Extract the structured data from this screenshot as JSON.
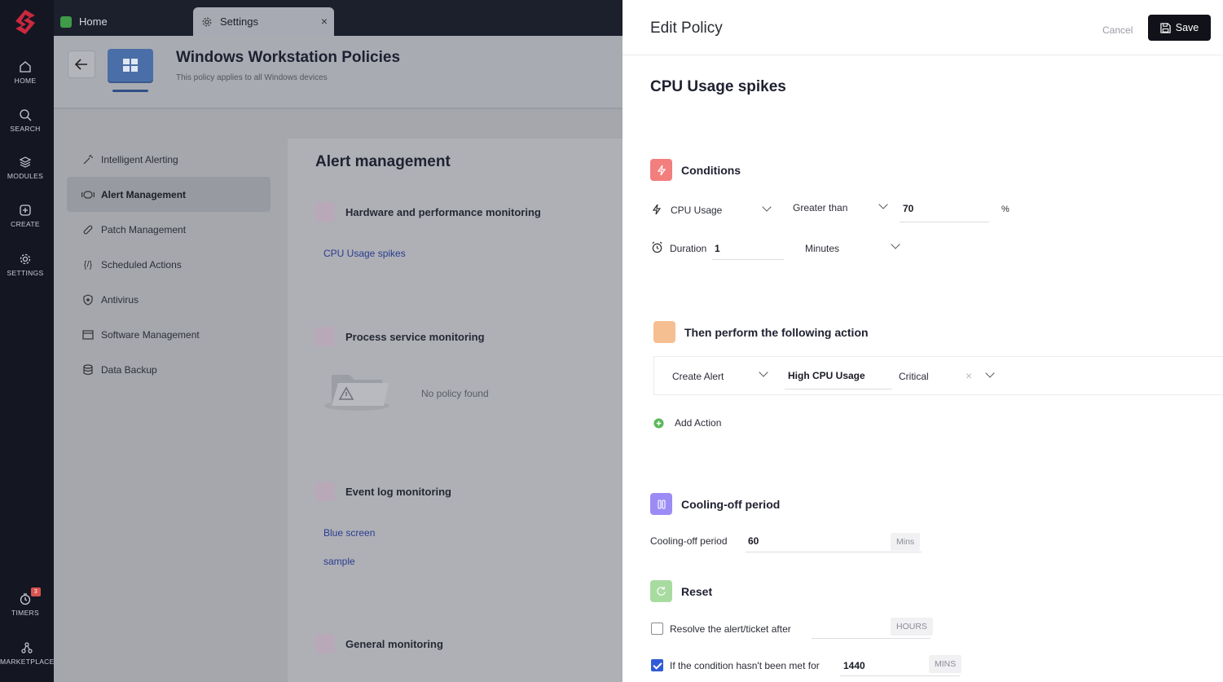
{
  "rail": {
    "items": [
      {
        "label": "HOME",
        "icon": "home-icon"
      },
      {
        "label": "SEARCH",
        "icon": "search-icon"
      },
      {
        "label": "MODULES",
        "icon": "layers-icon"
      },
      {
        "label": "CREATE",
        "icon": "plus-square-icon"
      },
      {
        "label": "SETTINGS",
        "icon": "gear-icon"
      },
      {
        "label": "TIMERS",
        "icon": "timer-icon",
        "badge": "3"
      },
      {
        "label": "MARKETPLACE",
        "icon": "marketplace-icon"
      }
    ]
  },
  "tabs": {
    "home": "Home",
    "settings": "Settings",
    "close": "×"
  },
  "header": {
    "title": "Windows Workstation Policies",
    "subtitle": "This policy applies to all Windows devices"
  },
  "subnav": {
    "items": [
      {
        "label": "Intelligent Alerting",
        "icon": "wand-icon",
        "active": false
      },
      {
        "label": "Alert Management",
        "icon": "radar-icon",
        "active": true
      },
      {
        "label": "Patch Management",
        "icon": "bandage-icon",
        "active": false
      },
      {
        "label": "Scheduled Actions",
        "icon": "code-icon",
        "active": false
      },
      {
        "label": "Antivirus",
        "icon": "shield-icon",
        "active": false
      },
      {
        "label": "Software Management",
        "icon": "window-code-icon",
        "active": false
      },
      {
        "label": "Data Backup",
        "icon": "database-icon",
        "active": false
      }
    ]
  },
  "panel": {
    "title": "Alert management",
    "sections": {
      "hardware": "Hardware and performance monitoring",
      "process": "Process service monitoring",
      "eventlog": "Event log monitoring",
      "general": "General monitoring"
    },
    "links": {
      "cpu": "CPU Usage spikes",
      "blue_screen": "Blue screen",
      "sample": "sample"
    },
    "no_policy": "No policy found"
  },
  "drawer": {
    "title": "Edit Policy",
    "cancel": "Cancel",
    "save": "Save",
    "policy_name": "CPU Usage spikes",
    "conditions": {
      "heading": "Conditions",
      "metric": "CPU Usage",
      "operator": "Greater than",
      "threshold": "70",
      "unit": "%",
      "duration_label": "Duration",
      "duration_value": "1",
      "duration_unit": "Minutes"
    },
    "actions": {
      "heading": "Then perform the following action",
      "type": "Create Alert",
      "name": "High CPU Usage",
      "severity": "Critical",
      "add": "Add Action"
    },
    "cooling": {
      "heading": "Cooling-off period",
      "label": "Cooling-off period",
      "value": "60",
      "unit": "Mins"
    },
    "reset": {
      "heading": "Reset",
      "resolve_label": "Resolve the alert/ticket after",
      "resolve_checked": false,
      "resolve_unit": "HOURS",
      "condition_label": "If the condition hasn't been met for",
      "condition_checked": true,
      "condition_value": "1440",
      "condition_unit": "MINS"
    }
  },
  "colors": {
    "conditions_icon": "#f27e7e",
    "action_icon": "#f6bf92",
    "cooling_icon": "#9b8cf5",
    "reset_icon": "#a8dba0",
    "save_bg": "#111219",
    "link": "#2a3c8f"
  }
}
